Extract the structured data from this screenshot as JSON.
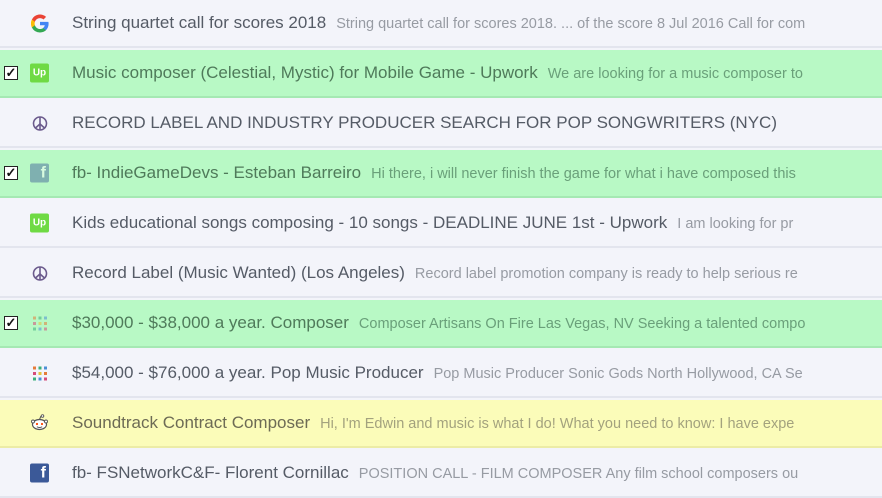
{
  "rows": [
    {
      "subject": "String quartet call for scores 2018",
      "snippet": "String quartet call for scores 2018. ... of the score 8 Jul 2016 Call for com",
      "icon": "google-icon",
      "checked": false,
      "highlight": "none"
    },
    {
      "subject": "Music composer (Celestial, Mystic) for Mobile Game - Upwork",
      "snippet": "We are looking for a music composer to",
      "icon": "upwork-icon",
      "checked": true,
      "highlight": "green"
    },
    {
      "subject": "RECORD LABEL AND INDUSTRY PRODUCER SEARCH FOR POP SONGWRITERS (NYC)",
      "snippet": "",
      "icon": "peace-icon",
      "checked": false,
      "highlight": "none"
    },
    {
      "subject": "fb- IndieGameDevs - Esteban Barreiro",
      "snippet": "Hi there, i will never finish the game for what i have composed this",
      "icon": "facebook-icon",
      "checked": true,
      "highlight": "green"
    },
    {
      "subject": "Kids educational songs composing - 10 songs - DEADLINE JUNE 1st - Upwork",
      "snippet": "I am looking for pr",
      "icon": "upwork-icon",
      "checked": false,
      "highlight": "none"
    },
    {
      "subject": "Record Label (Music Wanted) (Los Angeles)",
      "snippet": "Record label promotion company is ready to help serious re",
      "icon": "peace-icon",
      "checked": false,
      "highlight": "none"
    },
    {
      "subject": "$30,000 - $38,000 a year. Composer",
      "snippet": "Composer Artisans On Fire Las Vegas, NV Seeking a talented compo",
      "icon": "dots-icon",
      "checked": true,
      "highlight": "green"
    },
    {
      "subject": "$54,000 - $76,000 a year. Pop Music Producer",
      "snippet": "Pop Music Producer Sonic Gods North Hollywood, CA Se",
      "icon": "dots-icon",
      "checked": false,
      "highlight": "none"
    },
    {
      "subject": "Soundtrack Contract Composer",
      "snippet": "Hi, I'm Edwin and music is what I do! What you need to know:   I have expe",
      "icon": "reddit-icon",
      "checked": false,
      "highlight": "yellow"
    },
    {
      "subject": "fb- FSNetworkC&F- Florent Cornillac",
      "snippet": "POSITION CALL - FILM COMPOSER Any film school composers ou",
      "icon": "facebook-icon",
      "checked": false,
      "highlight": "none"
    }
  ]
}
